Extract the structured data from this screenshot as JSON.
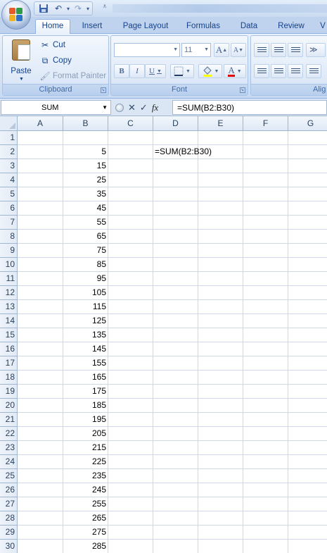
{
  "quick_access": {
    "icons": [
      "save-icon",
      "undo-icon",
      "redo-icon",
      "customize-qat-icon"
    ]
  },
  "ribbon": {
    "tabs": [
      "Home",
      "Insert",
      "Page Layout",
      "Formulas",
      "Data",
      "Review",
      "V"
    ],
    "active_tab": "Home",
    "clipboard": {
      "label": "Clipboard",
      "paste_label": "Paste",
      "cut_label": "Cut",
      "copy_label": "Copy",
      "format_painter_label": "Format Painter"
    },
    "font": {
      "label": "Font",
      "font_name": "",
      "font_size": "11",
      "bold": "B",
      "italic": "I",
      "underline": "U",
      "grow": "A",
      "shrink": "A",
      "color_letter": "A"
    },
    "alignment": {
      "label": "Alig"
    }
  },
  "formula_bar": {
    "name_box": "SUM",
    "cancel": "✕",
    "enter": "✓",
    "fx": "fx",
    "formula": "=SUM(B2:B30)"
  },
  "sheet": {
    "columns": [
      "A",
      "B",
      "C",
      "D",
      "E",
      "F",
      "G"
    ],
    "rows": [
      "1",
      "2",
      "3",
      "4",
      "5",
      "6",
      "7",
      "8",
      "9",
      "10",
      "11",
      "12",
      "13",
      "14",
      "15",
      "16",
      "17",
      "18",
      "19",
      "20",
      "21",
      "22",
      "23",
      "24",
      "25",
      "26",
      "27",
      "28",
      "29",
      "30"
    ],
    "column_b_values": [
      "",
      "5",
      "15",
      "25",
      "35",
      "45",
      "55",
      "65",
      "75",
      "85",
      "95",
      "105",
      "115",
      "125",
      "135",
      "145",
      "155",
      "165",
      "175",
      "185",
      "195",
      "205",
      "215",
      "225",
      "235",
      "245",
      "255",
      "265",
      "275",
      "285"
    ],
    "d2_edit_text": "=SUM(B2:B30)"
  },
  "colors": {
    "accent": "#15428b",
    "ribbon_bg": "#dfeaf8",
    "grid_line": "#d0d7e5",
    "header_border": "#9eb6ce"
  }
}
